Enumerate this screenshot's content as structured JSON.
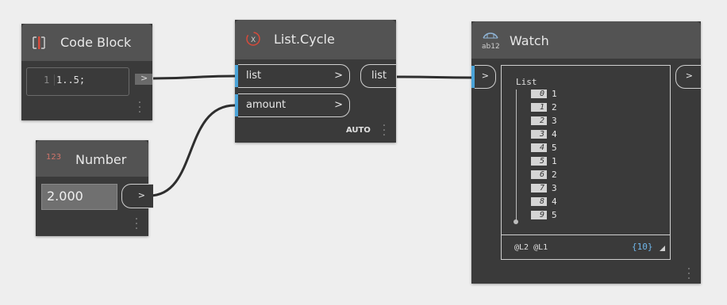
{
  "code_block": {
    "title": "Code Block",
    "line_number": "1",
    "code": "1..5;",
    "output_arrow": ">"
  },
  "number_node": {
    "title": "Number",
    "icon_text": "123",
    "value": "2.000",
    "output_arrow": ">"
  },
  "list_cycle": {
    "title": "List.Cycle",
    "input_list": "list",
    "input_amount": "amount",
    "arrow": ">",
    "output_list": "list",
    "lacing": "AUTO"
  },
  "watch": {
    "title": "Watch",
    "icon_text": "ab12",
    "input_arrow": ">",
    "output_arrow": ">",
    "list_header": "List",
    "items": [
      {
        "index": "0",
        "value": "1"
      },
      {
        "index": "1",
        "value": "2"
      },
      {
        "index": "2",
        "value": "3"
      },
      {
        "index": "3",
        "value": "4"
      },
      {
        "index": "4",
        "value": "5"
      },
      {
        "index": "5",
        "value": "1"
      },
      {
        "index": "6",
        "value": "2"
      },
      {
        "index": "7",
        "value": "3"
      },
      {
        "index": "8",
        "value": "4"
      },
      {
        "index": "9",
        "value": "5"
      }
    ],
    "levels": "@L2 @L1",
    "count": "{10}"
  },
  "colors": {
    "canvas": "#eeeeee",
    "node_body": "#3a3a3a",
    "node_header": "#535353",
    "port_accent": "#4aa3d8",
    "code_block_icon": "#d84a3a"
  }
}
